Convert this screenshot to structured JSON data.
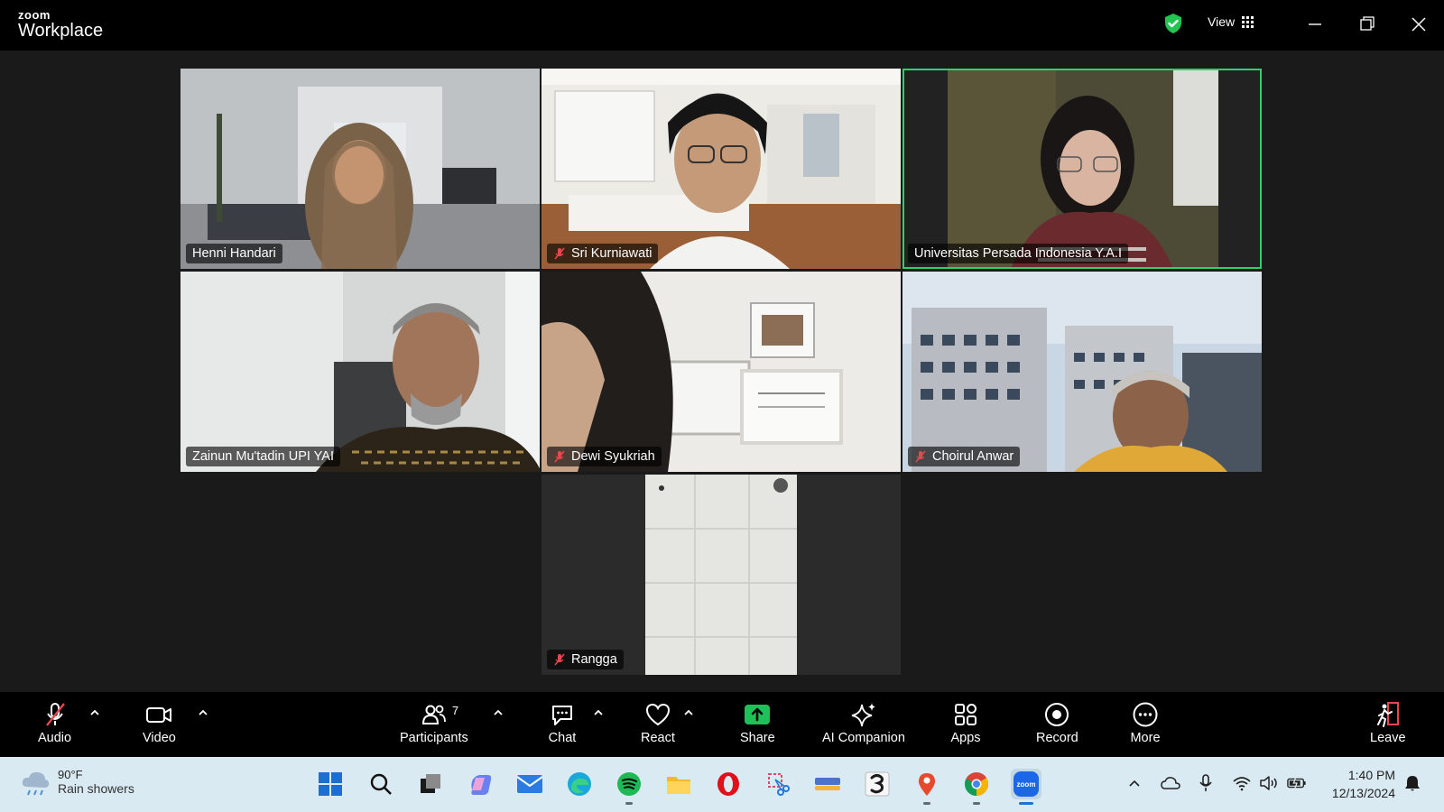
{
  "app": {
    "logo_top": "zoom",
    "logo_bottom": "Workplace"
  },
  "header": {
    "view_label": "View"
  },
  "participants": [
    {
      "name": "Henni Handari",
      "muted": false
    },
    {
      "name": "Sri Kurniawati",
      "muted": true
    },
    {
      "name": "Universitas Persada Indonesia Y.A.I",
      "muted": false,
      "active_speaker": true
    },
    {
      "name": "Zainun Mu'tadin UPI YAI",
      "muted": false
    },
    {
      "name": "Dewi Syukriah",
      "muted": true
    },
    {
      "name": "Choirul Anwar",
      "muted": true
    },
    {
      "name": "Rangga",
      "muted": true
    }
  ],
  "toolbar": {
    "audio": "Audio",
    "video": "Video",
    "participants": "Participants",
    "participants_count": "7",
    "chat": "Chat",
    "react": "React",
    "share": "Share",
    "ai_companion": "AI Companion",
    "apps": "Apps",
    "record": "Record",
    "more": "More",
    "leave": "Leave"
  },
  "taskbar": {
    "weather_temp": "90°F",
    "weather_desc": "Rain showers",
    "time": "1:40 PM",
    "date": "12/13/2024"
  },
  "colors": {
    "active_border": "#2bd46a",
    "share_green": "#1fbf5a",
    "leave_red": "#e5484d",
    "muted_red": "#e5484d"
  }
}
